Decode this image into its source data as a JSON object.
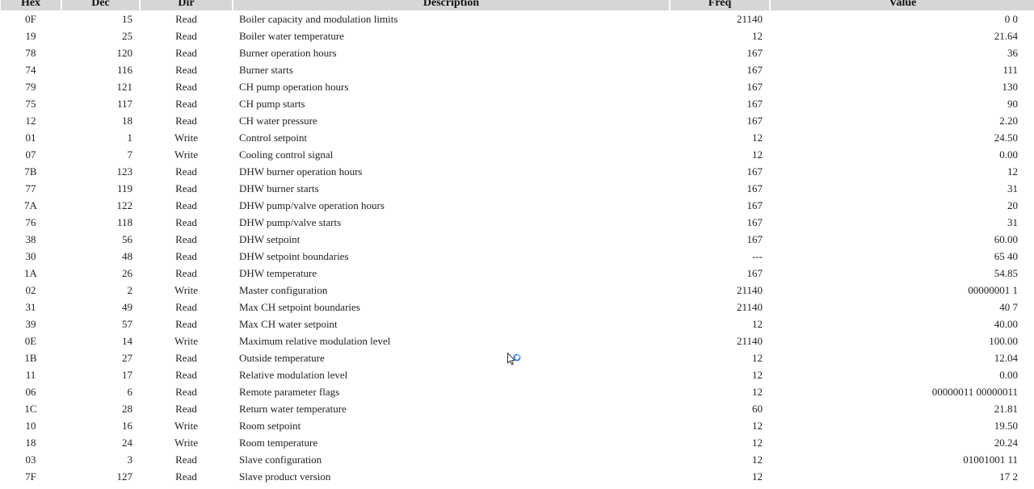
{
  "headers": {
    "hex": "Hex",
    "dec": "Dec",
    "dir": "Dir",
    "description": "Description",
    "freq": "Freq",
    "value": "Value"
  },
  "rows": [
    {
      "hex": "0F",
      "dec": "15",
      "dir": "Read",
      "description": "Boiler capacity and modulation limits",
      "freq": "21140",
      "value": "0 0"
    },
    {
      "hex": "19",
      "dec": "25",
      "dir": "Read",
      "description": "Boiler water temperature",
      "freq": "12",
      "value": "21.64"
    },
    {
      "hex": "78",
      "dec": "120",
      "dir": "Read",
      "description": "Burner operation hours",
      "freq": "167",
      "value": "36"
    },
    {
      "hex": "74",
      "dec": "116",
      "dir": "Read",
      "description": "Burner starts",
      "freq": "167",
      "value": "111"
    },
    {
      "hex": "79",
      "dec": "121",
      "dir": "Read",
      "description": "CH pump operation hours",
      "freq": "167",
      "value": "130"
    },
    {
      "hex": "75",
      "dec": "117",
      "dir": "Read",
      "description": "CH pump starts",
      "freq": "167",
      "value": "90"
    },
    {
      "hex": "12",
      "dec": "18",
      "dir": "Read",
      "description": "CH water pressure",
      "freq": "167",
      "value": "2.20"
    },
    {
      "hex": "01",
      "dec": "1",
      "dir": "Write",
      "description": "Control setpoint",
      "freq": "12",
      "value": "24.50"
    },
    {
      "hex": "07",
      "dec": "7",
      "dir": "Write",
      "description": "Cooling control signal",
      "freq": "12",
      "value": "0.00"
    },
    {
      "hex": "7B",
      "dec": "123",
      "dir": "Read",
      "description": "DHW burner operation hours",
      "freq": "167",
      "value": "12"
    },
    {
      "hex": "77",
      "dec": "119",
      "dir": "Read",
      "description": "DHW burner starts",
      "freq": "167",
      "value": "31"
    },
    {
      "hex": "7A",
      "dec": "122",
      "dir": "Read",
      "description": "DHW pump/valve operation hours",
      "freq": "167",
      "value": "20"
    },
    {
      "hex": "76",
      "dec": "118",
      "dir": "Read",
      "description": "DHW pump/valve starts",
      "freq": "167",
      "value": "31"
    },
    {
      "hex": "38",
      "dec": "56",
      "dir": "Read",
      "description": "DHW setpoint",
      "freq": "167",
      "value": "60.00"
    },
    {
      "hex": "30",
      "dec": "48",
      "dir": "Read",
      "description": "DHW setpoint boundaries",
      "freq": "---",
      "value": "65 40"
    },
    {
      "hex": "1A",
      "dec": "26",
      "dir": "Read",
      "description": "DHW temperature",
      "freq": "167",
      "value": "54.85"
    },
    {
      "hex": "02",
      "dec": "2",
      "dir": "Write",
      "description": "Master configuration",
      "freq": "21140",
      "value": "00000001 1"
    },
    {
      "hex": "31",
      "dec": "49",
      "dir": "Read",
      "description": "Max CH setpoint boundaries",
      "freq": "21140",
      "value": "40 7"
    },
    {
      "hex": "39",
      "dec": "57",
      "dir": "Read",
      "description": "Max CH water setpoint",
      "freq": "12",
      "value": "40.00"
    },
    {
      "hex": "0E",
      "dec": "14",
      "dir": "Write",
      "description": "Maximum relative modulation level",
      "freq": "21140",
      "value": "100.00"
    },
    {
      "hex": "1B",
      "dec": "27",
      "dir": "Read",
      "description": "Outside temperature",
      "freq": "12",
      "value": "12.04"
    },
    {
      "hex": "11",
      "dec": "17",
      "dir": "Read",
      "description": "Relative modulation level",
      "freq": "12",
      "value": "0.00"
    },
    {
      "hex": "06",
      "dec": "6",
      "dir": "Read",
      "description": "Remote parameter flags",
      "freq": "12",
      "value": "00000011 00000011"
    },
    {
      "hex": "1C",
      "dec": "28",
      "dir": "Read",
      "description": "Return water temperature",
      "freq": "60",
      "value": "21.81"
    },
    {
      "hex": "10",
      "dec": "16",
      "dir": "Write",
      "description": "Room setpoint",
      "freq": "12",
      "value": "19.50"
    },
    {
      "hex": "18",
      "dec": "24",
      "dir": "Write",
      "description": "Room temperature",
      "freq": "12",
      "value": "20.24"
    },
    {
      "hex": "03",
      "dec": "3",
      "dir": "Read",
      "description": "Slave configuration",
      "freq": "12",
      "value": "01001001 11"
    },
    {
      "hex": "7F",
      "dec": "127",
      "dir": "Read",
      "description": "Slave product version",
      "freq": "12",
      "value": "17 2"
    }
  ],
  "cursor_icon": "busy-pointer-icon"
}
